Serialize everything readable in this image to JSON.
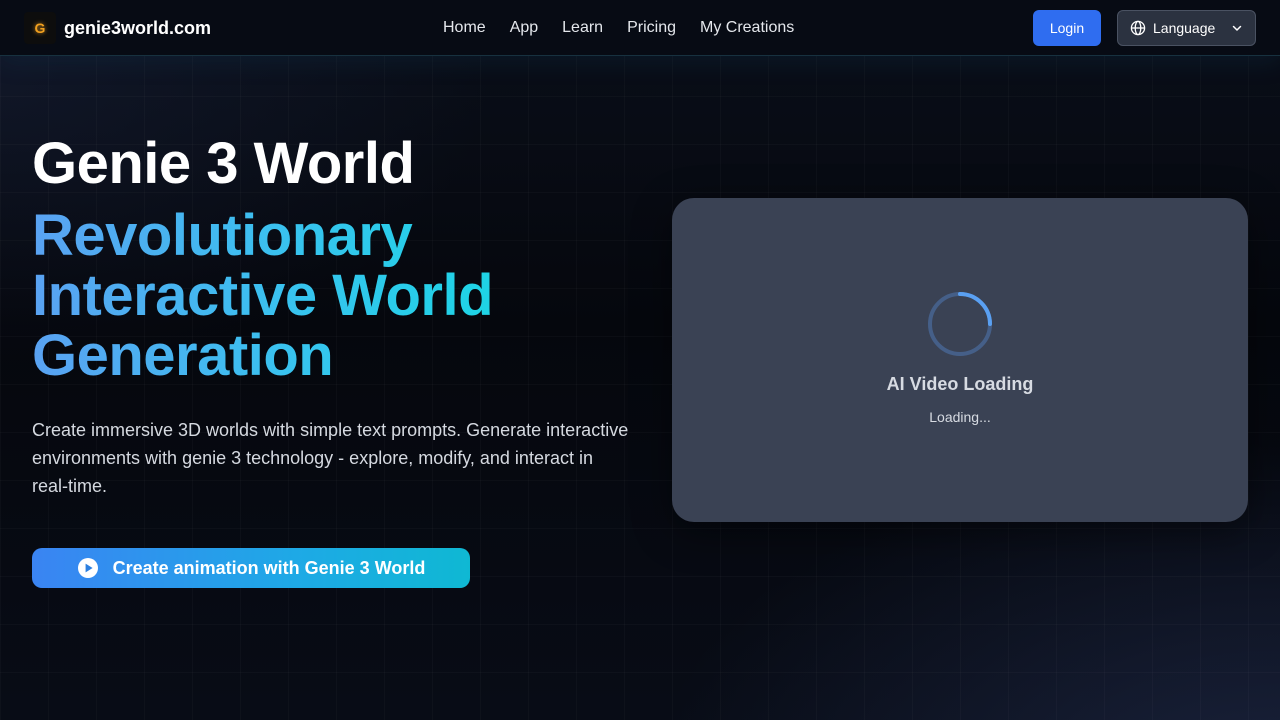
{
  "header": {
    "logo_letter": "G",
    "site_name": "genie3world.com",
    "nav": [
      {
        "label": "Home"
      },
      {
        "label": "App"
      },
      {
        "label": "Learn"
      },
      {
        "label": "Pricing"
      },
      {
        "label": "My Creations"
      }
    ],
    "login_label": "Login",
    "language_label": "Language",
    "language_icon": "globe-icon",
    "language_chevron_icon": "chevron-down-icon"
  },
  "hero": {
    "title": "Genie 3 World",
    "subtitle_lines": [
      "Revolutionary",
      "Interactive World",
      "Generation"
    ],
    "description": "Create immersive 3D worlds with simple text prompts. Generate interactive environments with genie 3 technology - explore, modify, and interact in real-time.",
    "cta_label": "Create animation with Genie 3 World",
    "cta_icon": "play-circle-icon"
  },
  "video_panel": {
    "title": "AI Video Loading",
    "status": "Loading...",
    "icon": "loading-spinner-icon"
  },
  "colors": {
    "accent_blue": "#2f6df0",
    "gradient_start": "#5aa2f2",
    "gradient_end": "#1fd3e6",
    "card_bg": "#3a4254"
  }
}
